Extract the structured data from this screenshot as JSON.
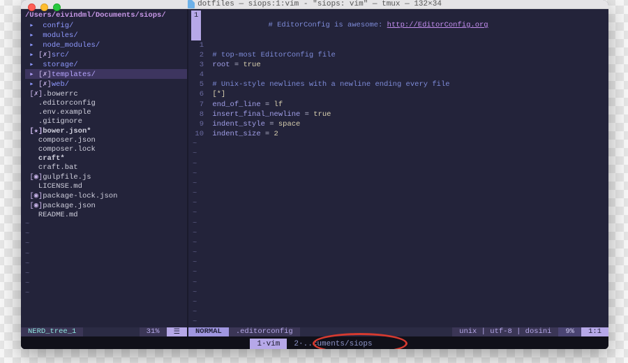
{
  "titlebar": {
    "title": "dotfiles — siops:1:vim - \"siops: vim\" — tmux — 132×34"
  },
  "tree": {
    "path": "/Users/eivindml/Documents/siops/",
    "items": [
      {
        "type": "dir",
        "mark": "▸",
        "name": " config/"
      },
      {
        "type": "dir",
        "mark": "▸",
        "name": " modules/"
      },
      {
        "type": "dir",
        "mark": "▸",
        "name": " node_modules/"
      },
      {
        "type": "dir",
        "mark": "▸",
        "icon": "[✗]",
        "name": "src/"
      },
      {
        "type": "dir",
        "mark": "▸",
        "name": " storage/"
      },
      {
        "type": "dir",
        "mark": "▸",
        "icon": "[✗]",
        "name": "templates/",
        "selected": true
      },
      {
        "type": "dir",
        "mark": "▸",
        "icon": "[✗]",
        "name": "web/"
      },
      {
        "type": "file",
        "icon": "[✗]",
        "name": ".bowerrc"
      },
      {
        "type": "file",
        "name": "  .editorconfig"
      },
      {
        "type": "file",
        "name": "  .env.example"
      },
      {
        "type": "file",
        "name": "  .gitignore"
      },
      {
        "type": "file",
        "icon": "[★]",
        "name": "bower.json*",
        "bold": true
      },
      {
        "type": "file",
        "name": "  composer.json"
      },
      {
        "type": "file",
        "name": "  composer.lock"
      },
      {
        "type": "file",
        "name": "  craft*",
        "bold": true
      },
      {
        "type": "file",
        "name": "  craft.bat"
      },
      {
        "type": "file",
        "icon": "[◉]",
        "name": "gulpfile.js"
      },
      {
        "type": "file",
        "name": "  LICENSE.md"
      },
      {
        "type": "file",
        "icon": "[◉]",
        "name": "package-lock.json"
      },
      {
        "type": "file",
        "icon": "[◉]",
        "name": "package.json"
      },
      {
        "type": "file",
        "name": "  README.md"
      }
    ]
  },
  "editor": {
    "banner_pre": "# EditorConfig is awesome: ",
    "banner_link": "http://EditorConfig.org",
    "lines": [
      {
        "n": 1,
        "text": ""
      },
      {
        "n": 2,
        "text": "# top-most EditorConfig file",
        "cls": "cc"
      },
      {
        "n": 3,
        "key": "root",
        "eq": " = ",
        "val": "true"
      },
      {
        "n": 4,
        "text": ""
      },
      {
        "n": 5,
        "text": "# Unix-style newlines with a newline ending every file",
        "cls": "cc"
      },
      {
        "n": 6,
        "text": "[*]",
        "cls": "cs"
      },
      {
        "n": 7,
        "key": "end_of_line",
        "eq": " = ",
        "val": "lf"
      },
      {
        "n": 8,
        "key": "insert_final_newline",
        "eq": " = ",
        "val": "true"
      },
      {
        "n": 9,
        "key": "indent_style",
        "eq": " = ",
        "val": "space"
      },
      {
        "n": 10,
        "key": "indent_size",
        "eq": " = ",
        "val": "2"
      }
    ]
  },
  "status_left": {
    "name": "NERD_tree_1",
    "pct": "31%",
    "mark": "☰"
  },
  "status_right": {
    "mode": "NORMAL",
    "file": ".editorconfig",
    "enc": "unix | utf-8 | dosini",
    "pct": "9%",
    "pos": "1:1"
  },
  "tmux": {
    "tabs": [
      {
        "label": "1·vim",
        "active": true
      },
      {
        "label": "2·..cuments/siops",
        "active": false
      }
    ]
  }
}
